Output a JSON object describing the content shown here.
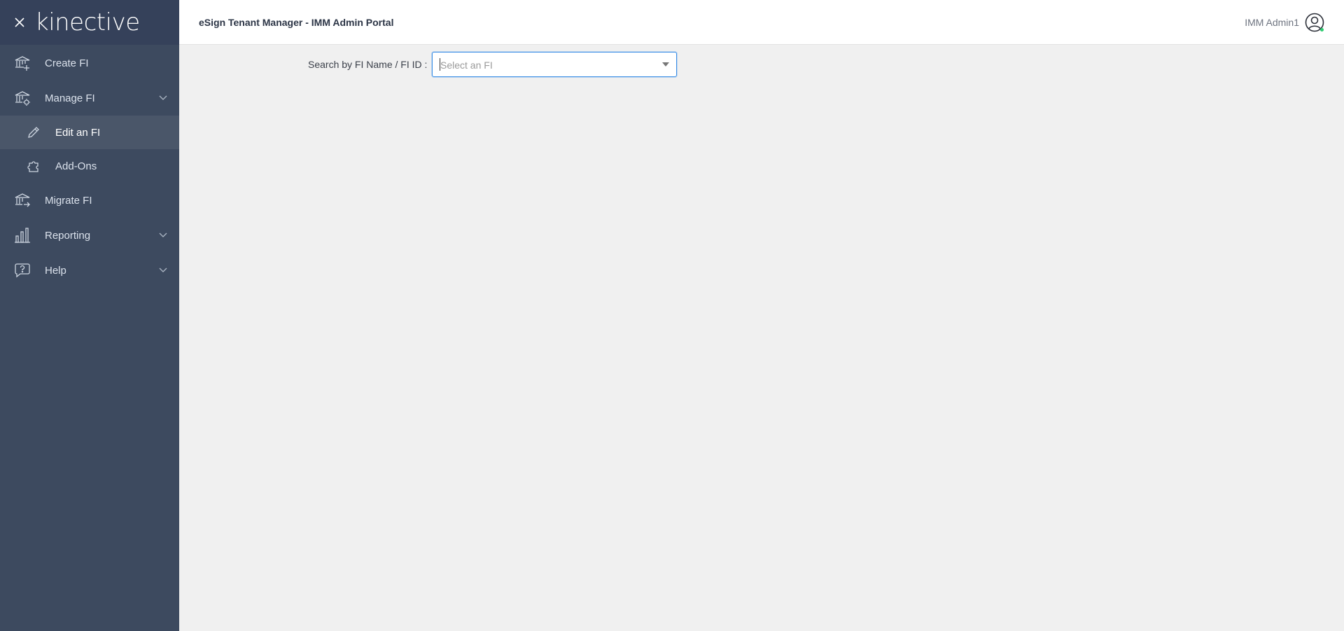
{
  "brand": {
    "logo_text": "kinective",
    "close_icon": "close-icon"
  },
  "sidebar": {
    "items": [
      {
        "label": "Create FI",
        "icon": "bank-plus-icon"
      },
      {
        "label": "Manage FI",
        "icon": "bank-gear-icon",
        "expanded": true,
        "children": [
          {
            "label": "Edit an FI",
            "icon": "pencil-icon",
            "active": true
          },
          {
            "label": "Add-Ons",
            "icon": "puzzle-icon"
          }
        ]
      },
      {
        "label": "Migrate FI",
        "icon": "bank-arrow-icon"
      },
      {
        "label": "Reporting",
        "icon": "bar-chart-icon",
        "expandable": true
      },
      {
        "label": "Help",
        "icon": "help-bubble-icon",
        "expandable": true
      }
    ]
  },
  "header": {
    "title": "eSign Tenant Manager - IMM Admin Portal"
  },
  "user": {
    "name": "IMM Admin1",
    "status_color": "#2ecc71"
  },
  "search": {
    "label": "Search by FI Name / FI ID :",
    "placeholder": "Select an FI",
    "value": ""
  },
  "colors": {
    "sidebar_bg": "#3d4a5f",
    "brand_bg": "#35415a",
    "active_item_bg": "#4a5669",
    "accent": "#3a8ee6",
    "content_bg": "#f0f0f0"
  }
}
